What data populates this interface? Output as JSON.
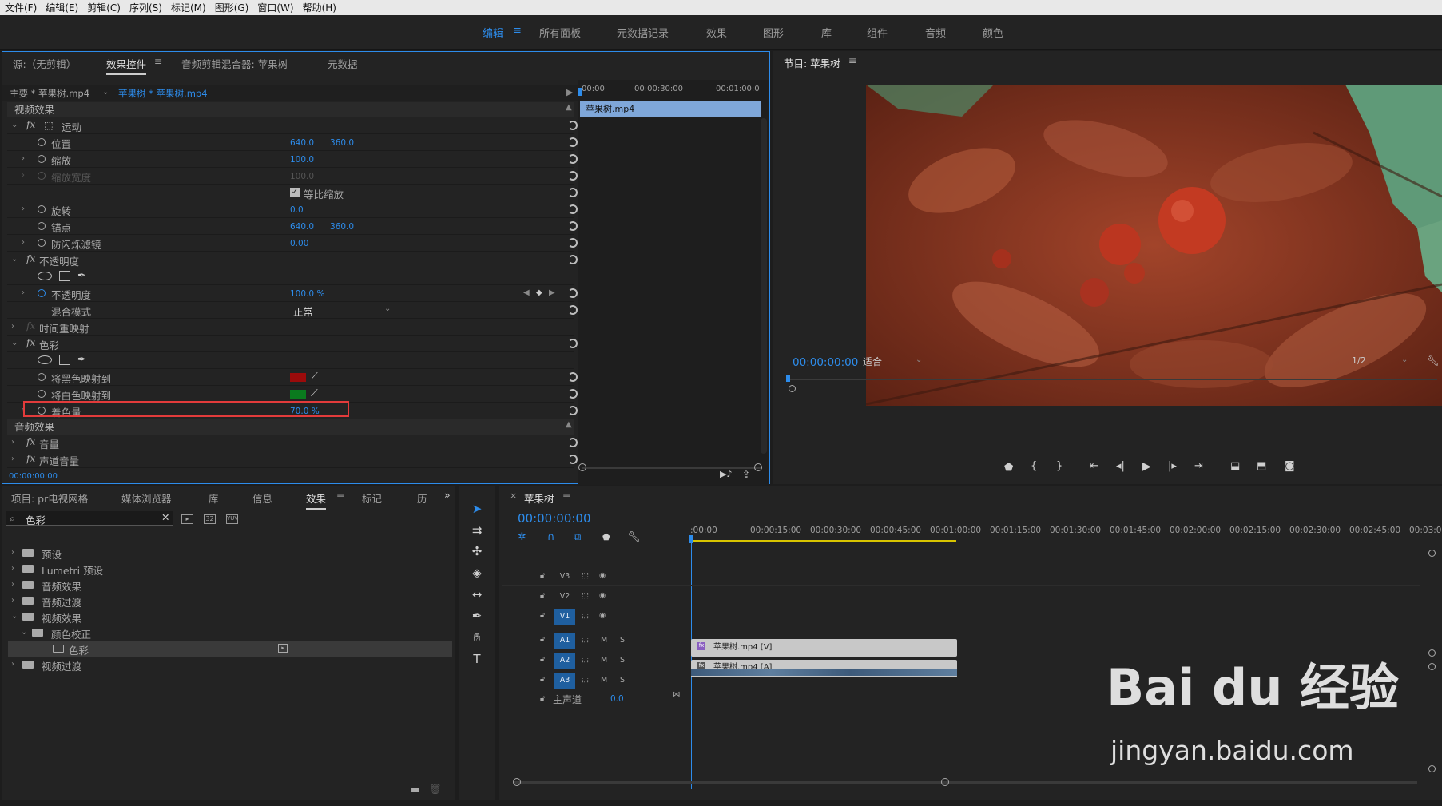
{
  "menu": [
    "文件(F)",
    "编辑(E)",
    "剪辑(C)",
    "序列(S)",
    "标记(M)",
    "图形(G)",
    "窗口(W)",
    "帮助(H)"
  ],
  "workspaces": {
    "active": "编辑",
    "items": [
      "所有面板",
      "元数据记录",
      "效果",
      "图形",
      "库",
      "组件",
      "音频",
      "颜色"
    ]
  },
  "ec_tabs": {
    "source": "源:（无剪辑）",
    "effect_controls": "效果控件",
    "audio_mixer": "音频剪辑混合器: 苹果树",
    "metadata": "元数据"
  },
  "ec_header": {
    "master": "主要 * 苹果树.mp4",
    "clip": "苹果树 * 苹果树.mp4"
  },
  "ec_timeline": {
    "ticks": [
      "00:00",
      "00:00:30:00",
      "00:01:00:0"
    ],
    "clip": "苹果树.mp4"
  },
  "sections": {
    "video": "视频效果",
    "audio": "音频效果"
  },
  "motion": {
    "title": "运动",
    "position": {
      "label": "位置",
      "x": "640.0",
      "y": "360.0"
    },
    "scale": {
      "label": "缩放",
      "value": "100.0"
    },
    "scale_width": {
      "label": "缩放宽度",
      "value": "100.0"
    },
    "uniform": "等比缩放",
    "rotation": {
      "label": "旋转",
      "value": "0.0"
    },
    "anchor": {
      "label": "锚点",
      "x": "640.0",
      "y": "360.0"
    },
    "flicker": {
      "label": "防闪烁滤镜",
      "value": "0.00"
    }
  },
  "opacity": {
    "title": "不透明度",
    "label": "不透明度",
    "value": "100.0 %",
    "blend_label": "混合模式",
    "blend_value": "正常"
  },
  "time_remap": "时间重映射",
  "tint": {
    "title": "色彩",
    "map_black": {
      "label": "将黑色映射到",
      "color": "#9b0b0b"
    },
    "map_white": {
      "label": "将白色映射到",
      "color": "#0a7a1e"
    },
    "amount": {
      "label": "着色量",
      "value": "70.0 %"
    }
  },
  "audio_fx": {
    "volume": "音量",
    "channel_volume": "声道音量"
  },
  "ec_timecode": "00:00:00:00",
  "program": {
    "title": "节目: 苹果树",
    "timecode": "00:00:00:00",
    "fit": "适合",
    "quality": "1/2"
  },
  "project": {
    "tabs": [
      "项目: pr电视网格",
      "媒体浏览器",
      "库",
      "信息",
      "效果",
      "标记",
      "历"
    ],
    "active_tab": "效果",
    "search": "色彩",
    "items": [
      {
        "label": "预设",
        "indent": 0,
        "open": false
      },
      {
        "label": "Lumetri 预设",
        "indent": 0,
        "open": false
      },
      {
        "label": "音频效果",
        "indent": 0,
        "open": false
      },
      {
        "label": "音频过渡",
        "indent": 0,
        "open": false
      },
      {
        "label": "视频效果",
        "indent": 0,
        "open": true
      },
      {
        "label": "颜色校正",
        "indent": 1,
        "open": true
      },
      {
        "label": "色彩",
        "indent": 2,
        "open": false
      },
      {
        "label": "视频过渡",
        "indent": 0,
        "open": false
      }
    ]
  },
  "timeline": {
    "title": "苹果树",
    "timecode": "00:00:00:00",
    "ruler": [
      ":00:00",
      "00:00:15:00",
      "00:00:30:00",
      "00:00:45:00",
      "00:01:00:00",
      "00:01:15:00",
      "00:01:30:00",
      "00:01:45:00",
      "00:02:00:00",
      "00:02:15:00",
      "00:02:30:00",
      "00:02:45:00",
      "00:03:00:0"
    ],
    "tracks": [
      "V3",
      "V2",
      "V1",
      "A1",
      "A2",
      "A3"
    ],
    "master": "主声道",
    "master_value": "0.0",
    "video_clip": "苹果树.mp4 [V]",
    "audio_clip": "苹果树.mp4 [A]",
    "mute": "M",
    "solo": "S"
  },
  "watermark": {
    "brand": "Bai du 经验",
    "url": "jingyan.baidu.com"
  },
  "colors": {
    "accent": "#2d8ceb",
    "highlight_box": "#e23b3b",
    "clip_blue": "#7fa7d9"
  }
}
